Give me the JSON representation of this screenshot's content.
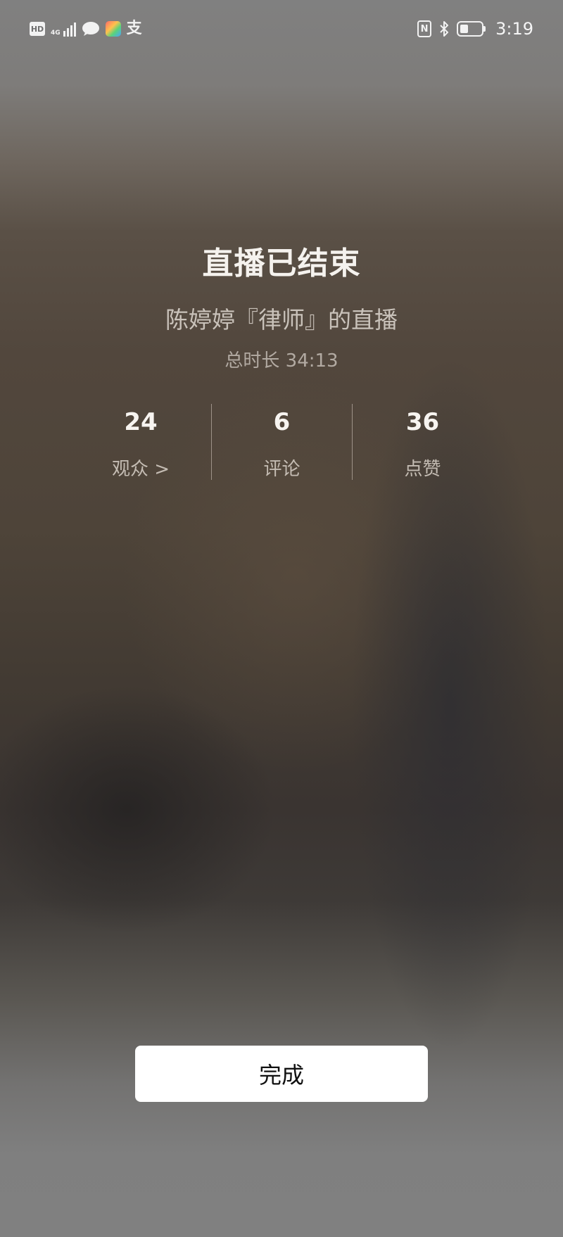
{
  "status_bar": {
    "hd_label": "HD",
    "network_label": "4G",
    "alipay_glyph": "支",
    "nfc_label": "N",
    "time": "3:19",
    "battery_level": 0.4,
    "icons": [
      "hd-icon",
      "signal-icon",
      "message-icon",
      "app-icon",
      "alipay-icon",
      "nfc-icon",
      "bluetooth-icon",
      "battery-icon"
    ]
  },
  "summary": {
    "title": "直播已结束",
    "subtitle": "陈婷婷『律师』的直播",
    "duration": "总时长 34:13"
  },
  "stats": [
    {
      "value": "24",
      "label": "观众 >"
    },
    {
      "value": "6",
      "label": "评论"
    },
    {
      "value": "36",
      "label": "点赞"
    }
  ],
  "actions": {
    "done_label": "完成"
  }
}
